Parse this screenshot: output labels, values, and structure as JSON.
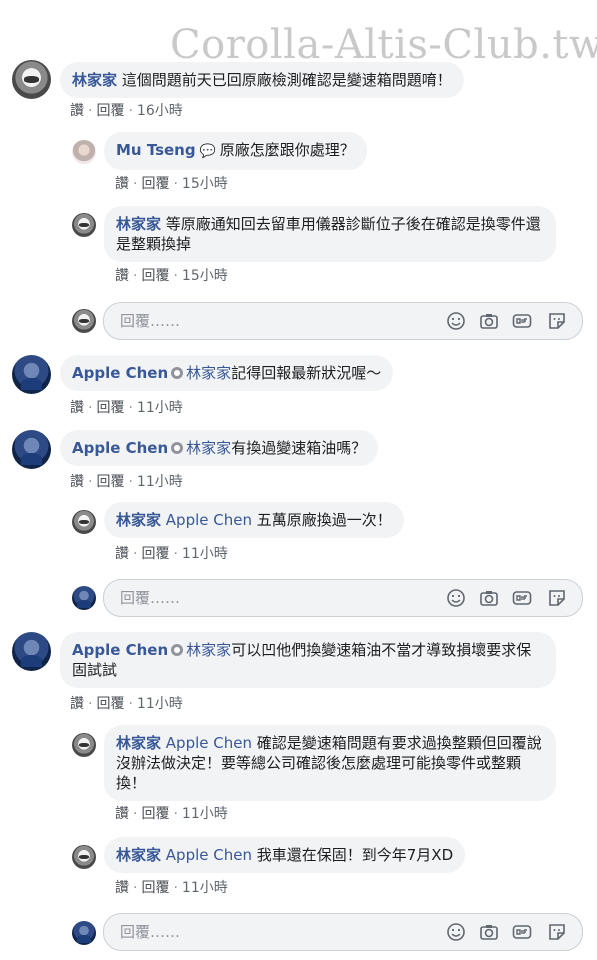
{
  "watermark": "Corolla-Altis-Club.tw",
  "reply_placeholder": "回覆……",
  "actions": {
    "like": "讚",
    "reply": "回覆"
  },
  "comments": [
    {
      "name": "林家家",
      "text": "這個問題前天已回原廠檢測確認是變速箱問題唷！",
      "time": "16小時"
    },
    {
      "name": "Mu Tseng",
      "text": "原廠怎麼跟你處理？",
      "time": "15小時"
    },
    {
      "name": "林家家",
      "text": "等原廠通知回去留車用儀器診斷位子後在確認是換零件還是整顆換掉",
      "time": "15小時"
    },
    {
      "name": "Apple Chen",
      "tag": "林家家",
      "text": "記得回報最新狀況喔～",
      "time": "11小時"
    },
    {
      "name": "Apple Chen",
      "tag": "林家家",
      "text": "有換過變速箱油嗎？",
      "time": "11小時"
    },
    {
      "name": "林家家",
      "tag": "Apple Chen",
      "text": "五萬原廠換過一次！",
      "time": "11小時"
    },
    {
      "name": "Apple Chen",
      "tag": "林家家",
      "text": "可以凹他們換變速箱油不當才導致損壞要求保固試試",
      "time": "11小時"
    },
    {
      "name": "林家家",
      "tag": "Apple Chen",
      "text": "確認是變速箱問題有要求過換整顆但回覆說沒辦法做決定！要等總公司確認後怎麼處理可能換零件或整顆換！",
      "time": "11小時"
    },
    {
      "name": "林家家",
      "tag": "Apple Chen",
      "text": "我車還在保固！到今年7月XD",
      "time": "11小時"
    }
  ]
}
